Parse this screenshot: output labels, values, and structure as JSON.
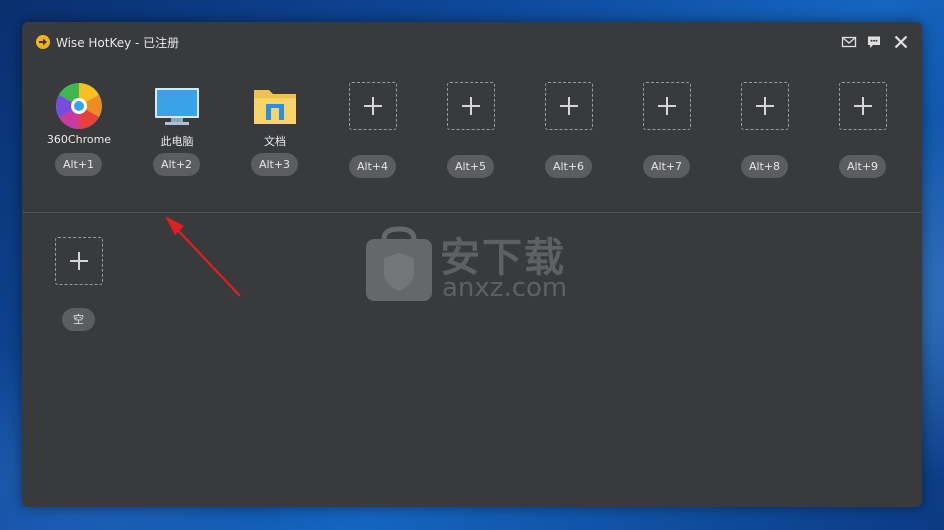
{
  "window": {
    "title": "Wise HotKey - 已注册",
    "buttons": {
      "mail": "mail-icon",
      "feedback": "chat-icon",
      "close": "close-icon"
    }
  },
  "row1": [
    {
      "app": "360Chrome",
      "icon": "chrome360-icon",
      "hotkey": "Alt+1"
    },
    {
      "app": "此电脑",
      "icon": "computer-icon",
      "hotkey": "Alt+2"
    },
    {
      "app": "文档",
      "icon": "folder-icon",
      "hotkey": "Alt+3"
    },
    {
      "app": "",
      "icon": "add-icon",
      "hotkey": "Alt+4"
    },
    {
      "app": "",
      "icon": "add-icon",
      "hotkey": "Alt+5"
    },
    {
      "app": "",
      "icon": "add-icon",
      "hotkey": "Alt+6"
    },
    {
      "app": "",
      "icon": "add-icon",
      "hotkey": "Alt+7"
    },
    {
      "app": "",
      "icon": "add-icon",
      "hotkey": "Alt+8"
    },
    {
      "app": "",
      "icon": "add-icon",
      "hotkey": "Alt+9"
    }
  ],
  "row2": [
    {
      "app": "",
      "icon": "add-icon",
      "hotkey": "空"
    }
  ],
  "watermark": {
    "main": "安下载",
    "sub": "anxz.com"
  },
  "colors": {
    "window_bg": "#393a3c",
    "hotkey_bg": "#5c5d5f",
    "annotation_arrow": "#e02020"
  }
}
